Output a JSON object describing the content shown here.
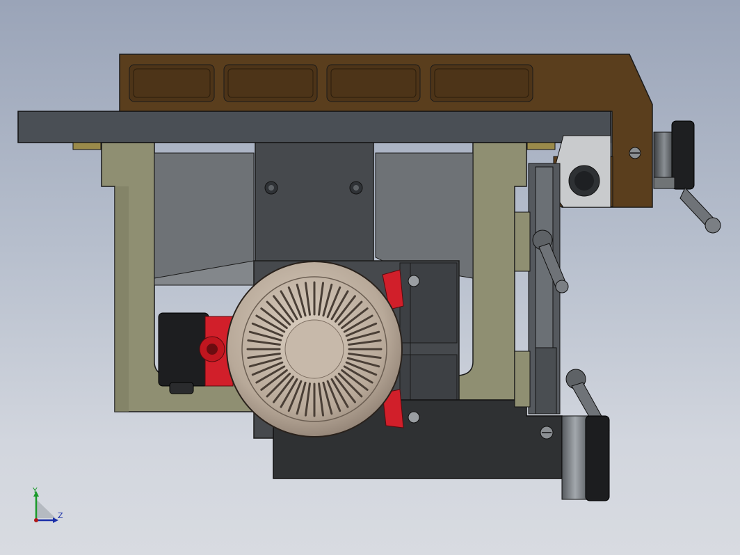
{
  "viewport": {
    "background_top": "#9aa4b8",
    "background_bottom": "#d8dbe1"
  },
  "colors": {
    "frame": "#8f8f72",
    "fence_bar": "#4a4f55",
    "bracket": "#5a3e1d",
    "housing": "#46494d",
    "motor_cover": "#b8a999",
    "motor_accent": "#d11f2a",
    "handle": "#6f7378"
  },
  "triad": {
    "y_label": "Y",
    "z_label": "Z",
    "y_color": "#1a9a2a",
    "z_color": "#1a2fa8",
    "origin_color": "#b01a1a"
  }
}
